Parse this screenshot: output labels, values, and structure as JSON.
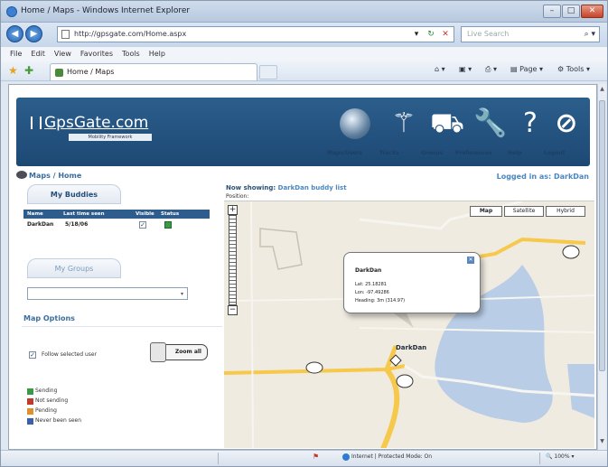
{
  "window": {
    "title": "Home / Maps - Windows Internet Explorer"
  },
  "address": {
    "url": "http://gpsgate.com/Home.aspx",
    "search_placeholder": "Live Search"
  },
  "menu": [
    "File",
    "Edit",
    "View",
    "Favorites",
    "Tools",
    "Help"
  ],
  "tab": {
    "label": "Home / Maps"
  },
  "commands": {
    "page": "Page",
    "tools": "Tools"
  },
  "site": {
    "logo": "GpsGate.com",
    "tagline": "Mobility Framework",
    "nav": [
      "Maps/Users",
      "Tracks",
      "Groups",
      "Preferences",
      "Help",
      "Logout"
    ]
  },
  "breadcrumb": "Maps / Home",
  "logged_in": "Logged in as: DarkDan",
  "buddies": {
    "title": "My Buddies",
    "columns": [
      "Name",
      "Last time seen",
      "Visible",
      "Status"
    ],
    "rows": [
      {
        "name": "DarkDan",
        "last_seen": "5/18/06",
        "visible": "✓"
      }
    ]
  },
  "groups": {
    "title": "My Groups"
  },
  "map_options": {
    "title": "Map Options",
    "follow": "Follow selected user",
    "zoom_button": "Zoom all",
    "legend": [
      {
        "label": "Sending",
        "color": "#3a9a45"
      },
      {
        "label": "Not sending",
        "color": "#c23a2e"
      },
      {
        "label": "Pending",
        "color": "#e0902a"
      },
      {
        "label": "Never been seen",
        "color": "#3b5fa8"
      }
    ]
  },
  "main": {
    "showing_prefix": "Now showing:",
    "showing": "DarkDan buddy list",
    "position": "Position:"
  },
  "map": {
    "types": [
      "Map",
      "Satellite",
      "Hybrid"
    ],
    "marker_label": "DarkDan",
    "popup": {
      "name": "DarkDan",
      "lat": "Lat: 25.18281",
      "lon": "Lon: -97.49286",
      "heading": "Heading: 3m (314.97)"
    }
  },
  "status": {
    "zone": "Internet | Protected Mode: On",
    "zoom": "100%"
  }
}
